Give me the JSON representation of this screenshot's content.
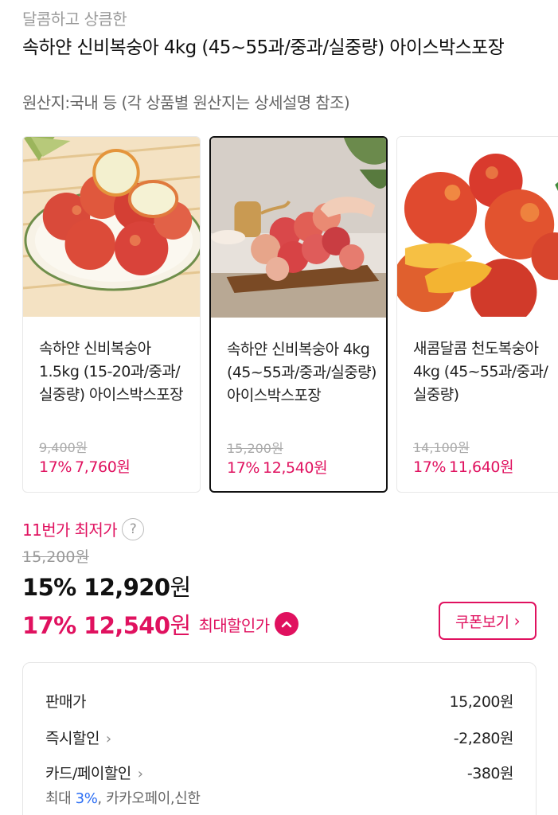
{
  "header": {
    "subtitle": "달콤하고 상큼한",
    "title": "속하얀 신비복숭아 4kg (45~55과/중과/실중량) 아이스박스포장",
    "origin": "원산지:국내 등 (각 상품별 원산지는 상세설명 참조)"
  },
  "options": [
    {
      "name": "속하얀 신비복숭아 1.5kg (15-20과/중과/실중량) 아이스박스포장",
      "original_price": "9,400원",
      "discount_rate": "17%",
      "sale_price": "7,760원",
      "selected": false
    },
    {
      "name": "속하얀 신비복숭아 4kg (45~55과/중과/실중량) 아이스박스포장",
      "original_price": "15,200원",
      "discount_rate": "17%",
      "sale_price": "12,540원",
      "selected": true
    },
    {
      "name": "새콤달콤 천도복숭아 4kg (45~55과/중과/실중량)",
      "original_price": "14,100원",
      "discount_rate": "17%",
      "sale_price": "11,640원",
      "selected": false
    }
  ],
  "pricing": {
    "lowest_label": "11번가 최저가",
    "help_icon_text": "?",
    "list_price": "15,200원",
    "price_15": {
      "rate": "15%",
      "amount": "12,920",
      "unit": "원"
    },
    "price_17": {
      "rate": "17%",
      "amount": "12,540",
      "unit": "원",
      "label": "최대할인가"
    },
    "coupon_button": "쿠폰보기"
  },
  "breakdown": {
    "rows": [
      {
        "label": "판매가",
        "amount": "15,200원"
      },
      {
        "label": "즉시할인",
        "amount": "-2,280원"
      },
      {
        "label": "카드/페이할인",
        "amount": "-380원"
      }
    ],
    "card_note": {
      "prefix": "최대 ",
      "highlight": "3%",
      "suffix": ", 카카오페이,신한"
    }
  },
  "colors": {
    "accent": "#e0115f",
    "link_blue": "#2a6df4"
  },
  "icons": [
    "question-circle-icon",
    "chevron-up-icon",
    "chevron-right-icon"
  ]
}
